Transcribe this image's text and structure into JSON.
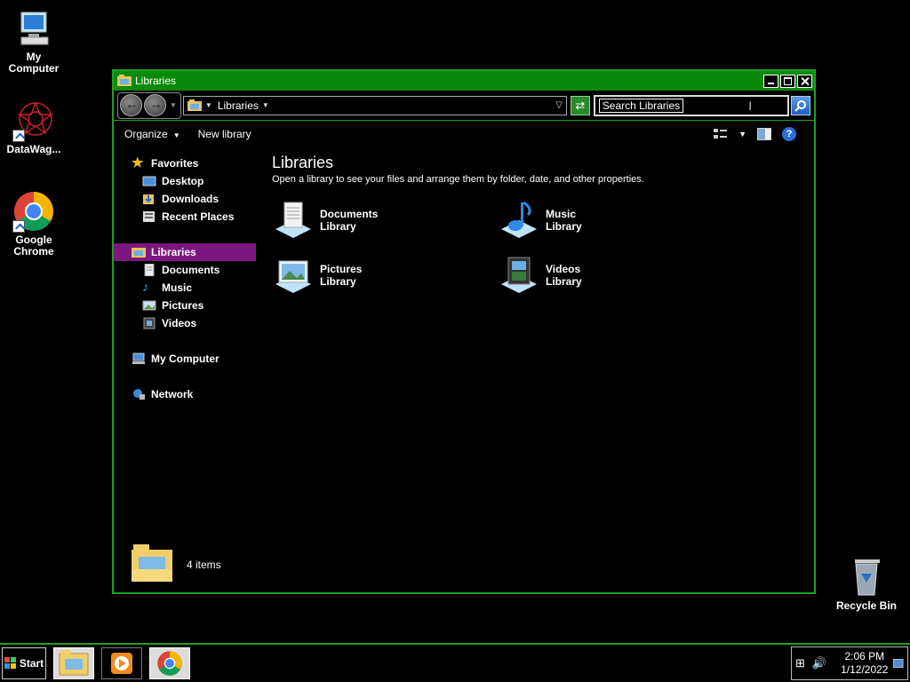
{
  "desktop": {
    "icons": [
      {
        "label": "My Computer"
      },
      {
        "label": "DataWag..."
      },
      {
        "label": "Google Chrome"
      },
      {
        "label": "Recycle Bin"
      }
    ]
  },
  "window": {
    "title": "Libraries",
    "address": {
      "crumb": "Libraries"
    },
    "search": {
      "placeholder": "Search Libraries"
    },
    "toolbar": {
      "organize": "Organize",
      "new_library": "New library"
    },
    "nav": {
      "favorites": "Favorites",
      "favorites_items": [
        "Desktop",
        "Downloads",
        "Recent Places"
      ],
      "libraries": "Libraries",
      "libraries_items": [
        "Documents",
        "Music",
        "Pictures",
        "Videos"
      ],
      "computer": "My Computer",
      "network": "Network"
    },
    "content": {
      "heading": "Libraries",
      "description": "Open a library to see your files and arrange them by folder, date, and other properties.",
      "libraries": [
        {
          "name": "Documents",
          "sub": "Library"
        },
        {
          "name": "Music",
          "sub": "Library"
        },
        {
          "name": "Pictures",
          "sub": "Library"
        },
        {
          "name": "Videos",
          "sub": "Library"
        }
      ]
    },
    "details": {
      "count": "4 items"
    }
  },
  "taskbar": {
    "start_label": "Start",
    "clock_time": "2:06 PM",
    "clock_date": "1/12/2022"
  },
  "colors": {
    "window_border": "#1ea01e",
    "titlebar": "#0a8a0a",
    "selection": "#7d1780"
  }
}
